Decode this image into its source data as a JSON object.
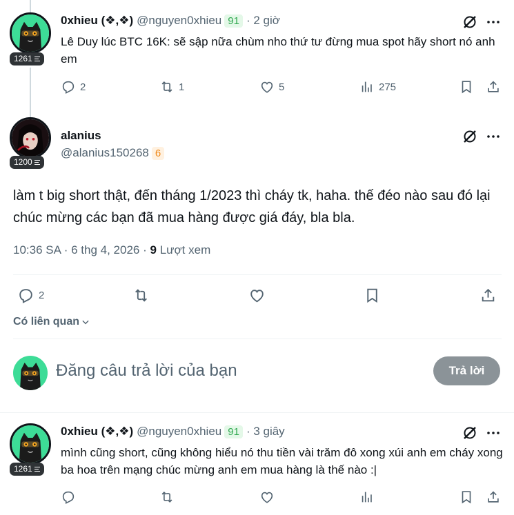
{
  "post1": {
    "name": "0xhieu (❖,❖)",
    "handle": "@nguyen0xhieu",
    "badge": "91",
    "time": "· 2 giờ",
    "level": "1261",
    "text": "Lê Duy lúc BTC 16K: sẽ sập nữa chùm nho thứ tư đừng mua spot hãy short nó anh em",
    "replies": "2",
    "reposts": "1",
    "likes": "5",
    "views": "275"
  },
  "main": {
    "name": "alanius",
    "handle": "@alanius150268",
    "badge": "6",
    "level": "1200",
    "text": "làm t big short thật, đến tháng 1/2023 thì cháy tk, haha. thế đéo nào sau đó lại chúc mừng các bạn đã mua hàng được giá đáy, bla bla.",
    "timestamp": "10:36 SA · 6 thg 4, 2026 ·",
    "views_count": "9",
    "views_label": "Lượt xem",
    "replies": "2",
    "related": "Có liên quan"
  },
  "composer": {
    "placeholder": "Đăng câu trả lời của bạn",
    "button": "Trả lời"
  },
  "post2": {
    "name": "0xhieu (❖,❖)",
    "handle": "@nguyen0xhieu",
    "badge": "91",
    "time": "· 3 giây",
    "level": "1261",
    "text": "mình cũng short, cũng không hiểu nó thu tiền vài trăm đô xong xúi anh em cháy xong ba hoa trên mạng chúc mừng anh em mua hàng là thế nào :|"
  },
  "icons": {
    "more": "more-icon",
    "grok": "grok-icon",
    "reply": "reply-icon",
    "repost": "repost-icon",
    "like": "like-icon",
    "views": "views-icon",
    "bookmark": "bookmark-icon",
    "share": "share-icon"
  }
}
